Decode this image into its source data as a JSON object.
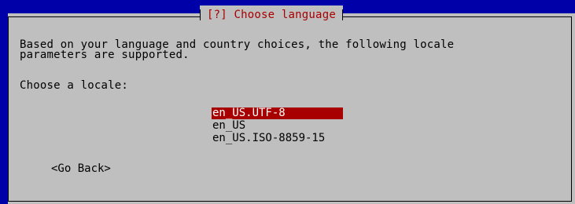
{
  "dialog": {
    "title": "[?] Choose language",
    "description_line1": "Based on your language and country choices, the following locale",
    "description_line2": "parameters are supported.",
    "prompt": "Choose a locale:",
    "locales": [
      "en_US.UTF-8",
      "en_US",
      "en_US.ISO-8859-15"
    ],
    "selected_index": 0,
    "go_back_label": "<Go Back>"
  },
  "colors": {
    "background": "#0000a8",
    "dialog": "#bfbfbf",
    "accent": "#a80000",
    "text": "#000000",
    "selected_text": "#ffffff"
  }
}
